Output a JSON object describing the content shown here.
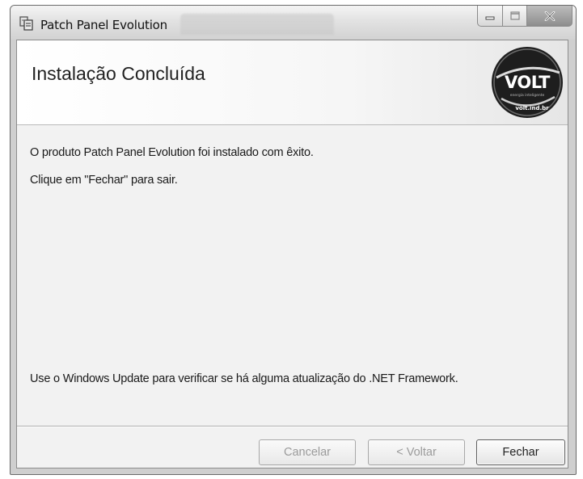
{
  "window": {
    "title": "Patch Panel Evolution",
    "controls": {
      "minimize_icon": "minimize-icon",
      "maximize_icon": "maximize-icon",
      "close_icon": "close-icon"
    }
  },
  "banner": {
    "title": "Instalação Concluída",
    "logo": {
      "brand": "VOLT",
      "tagline": "energia inteligente",
      "url": "volt.ind.br"
    }
  },
  "content": {
    "message": "O produto Patch Panel Evolution foi instalado com êxito.",
    "instruction": "Clique em \"Fechar\" para sair.",
    "update_note": "Use o Windows Update para verificar se há alguma atualização do .NET Framework."
  },
  "buttons": {
    "cancel": "Cancelar",
    "back": "< Voltar",
    "close": "Fechar"
  },
  "colors": {
    "disabled_text": "#9b9b9b",
    "enabled_text": "#222222"
  }
}
